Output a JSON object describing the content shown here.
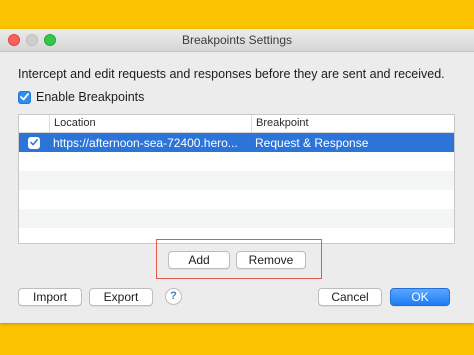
{
  "window": {
    "title": "Breakpoints Settings"
  },
  "description": "Intercept and edit requests and responses before they are sent and received.",
  "enable_breakpoints": {
    "label": "Enable Breakpoints",
    "checked": true
  },
  "table": {
    "columns": [
      "Location",
      "Breakpoint"
    ],
    "rows": [
      {
        "enabled": true,
        "location": "https://afternoon-sea-72400.hero...",
        "breakpoint": "Request & Response"
      }
    ]
  },
  "buttons": {
    "add": "Add",
    "remove": "Remove",
    "import": "Import",
    "export": "Export",
    "help": "?",
    "cancel": "Cancel",
    "ok": "OK"
  },
  "colors": {
    "background": "#fcc400",
    "selection": "#2d74d9",
    "accent": "#1f7cf5",
    "highlight_border": "#e05a4e"
  }
}
